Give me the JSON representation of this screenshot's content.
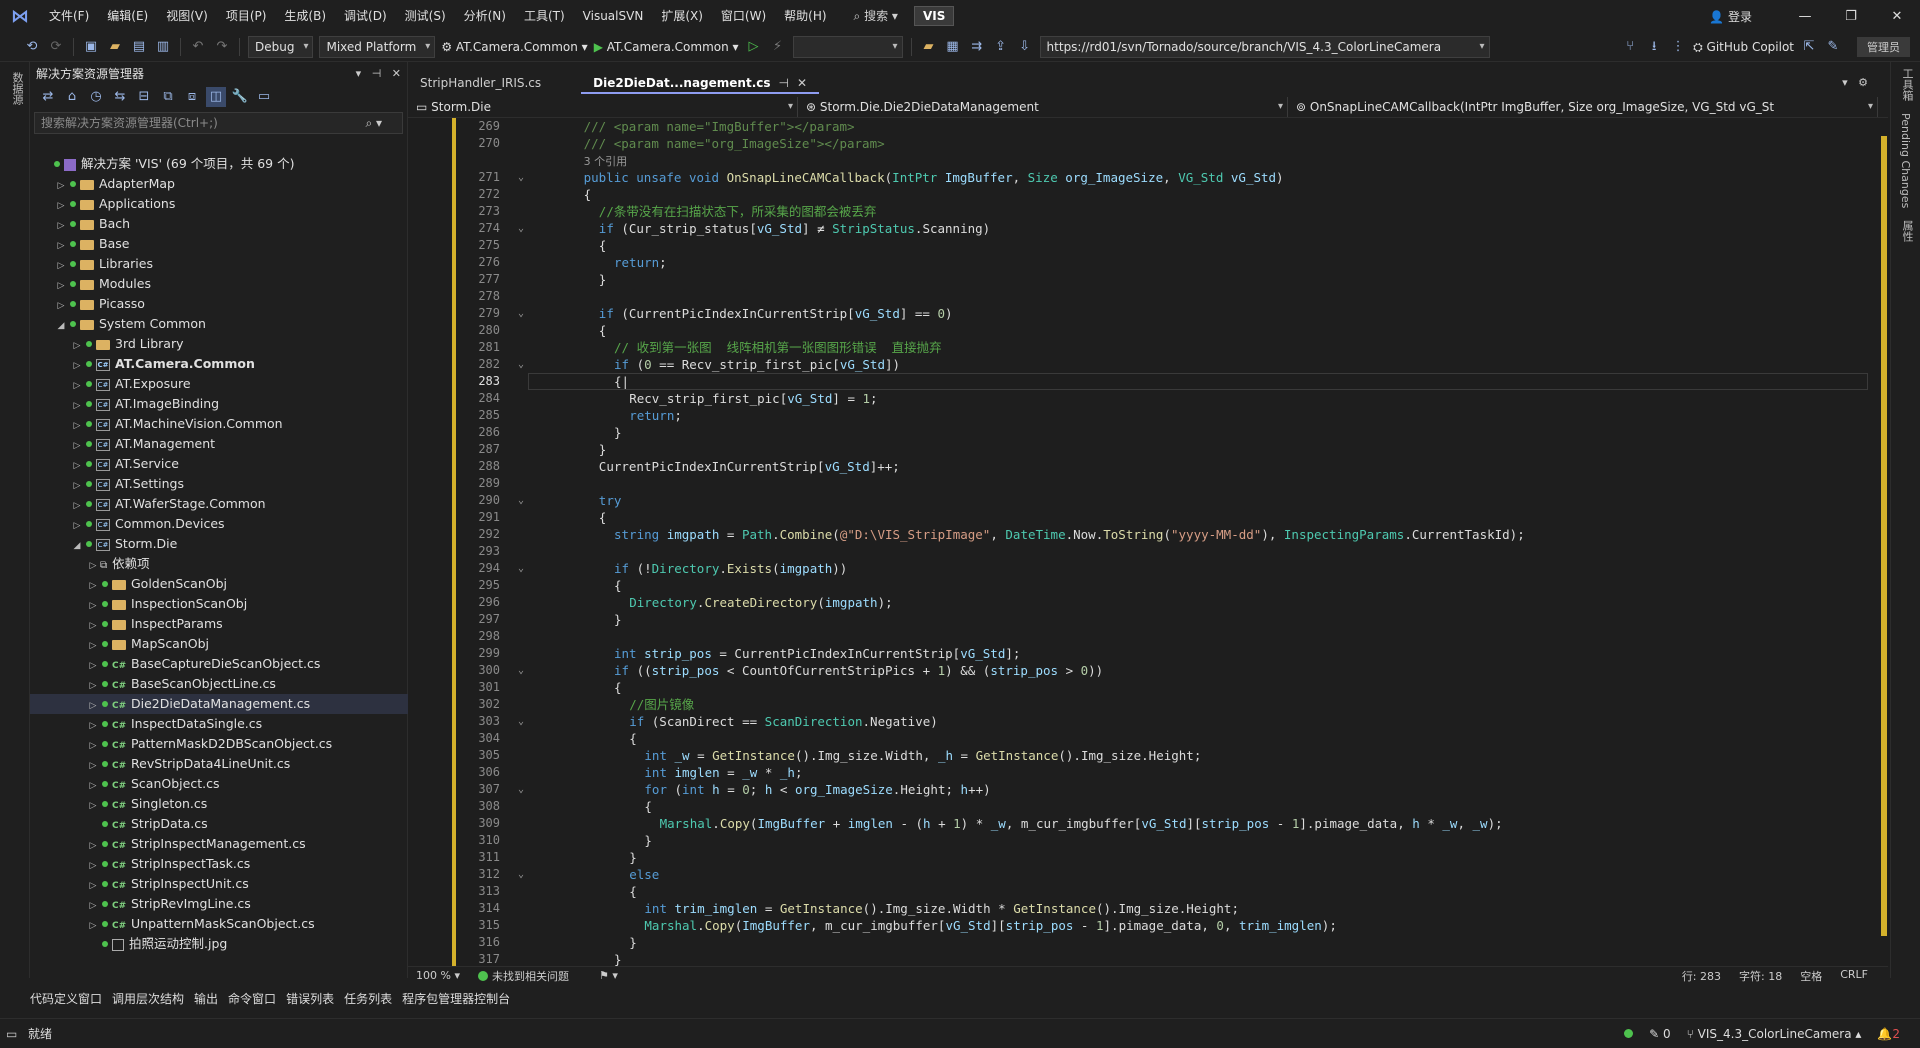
{
  "menu": {
    "items": [
      "文件(F)",
      "编辑(E)",
      "视图(V)",
      "项目(P)",
      "生成(B)",
      "调试(D)",
      "测试(S)",
      "分析(N)",
      "工具(T)",
      "VisualSVN",
      "扩展(X)",
      "窗口(W)",
      "帮助(H)"
    ],
    "search": "搜索",
    "solution_badge": "VIS",
    "login": "登录"
  },
  "toolbar": {
    "config": "Debug",
    "platform": "Mixed Platform",
    "startup_project": "AT.Camera.Common",
    "run_target": "AT.Camera.Common",
    "url": "https://rd01/svn/Tornado/source/branch/VIS_4.3_ColorLineCamera",
    "copilot": "GitHub Copilot",
    "admin": "管理员"
  },
  "left_strip": {
    "label": "数据源"
  },
  "solution_explorer": {
    "title": "解决方案资源管理器",
    "search_placeholder": "搜索解决方案资源管理器(Ctrl+;)",
    "tree": [
      {
        "label": "解决方案 'VIS' (69 个项目，共 69 个)",
        "indent": 0,
        "kind": "solution",
        "arrow": ""
      },
      {
        "label": "AdapterMap",
        "indent": 1,
        "kind": "folder",
        "arrow": "▷"
      },
      {
        "label": "Applications",
        "indent": 1,
        "kind": "folder",
        "arrow": "▷"
      },
      {
        "label": "Bach",
        "indent": 1,
        "kind": "folder",
        "arrow": "▷"
      },
      {
        "label": "Base",
        "indent": 1,
        "kind": "folder",
        "arrow": "▷"
      },
      {
        "label": "Libraries",
        "indent": 1,
        "kind": "folder",
        "arrow": "▷"
      },
      {
        "label": "Modules",
        "indent": 1,
        "kind": "folder",
        "arrow": "▷"
      },
      {
        "label": "Picasso",
        "indent": 1,
        "kind": "folder",
        "arrow": "▷"
      },
      {
        "label": "System Common",
        "indent": 1,
        "kind": "folder",
        "arrow": "◢"
      },
      {
        "label": "3rd Library",
        "indent": 2,
        "kind": "folder",
        "arrow": "▷"
      },
      {
        "label": "AT.Camera.Common",
        "indent": 2,
        "kind": "proj",
        "arrow": "▷",
        "bold": true
      },
      {
        "label": "AT.Exposure",
        "indent": 2,
        "kind": "proj",
        "arrow": "▷"
      },
      {
        "label": "AT.ImageBinding",
        "indent": 2,
        "kind": "proj",
        "arrow": "▷"
      },
      {
        "label": "AT.MachineVision.Common",
        "indent": 2,
        "kind": "proj",
        "arrow": "▷"
      },
      {
        "label": "AT.Management",
        "indent": 2,
        "kind": "proj",
        "arrow": "▷"
      },
      {
        "label": "AT.Service",
        "indent": 2,
        "kind": "proj",
        "arrow": "▷"
      },
      {
        "label": "AT.Settings",
        "indent": 2,
        "kind": "proj",
        "arrow": "▷"
      },
      {
        "label": "AT.WaferStage.Common",
        "indent": 2,
        "kind": "proj",
        "arrow": "▷"
      },
      {
        "label": "Common.Devices",
        "indent": 2,
        "kind": "proj",
        "arrow": "▷"
      },
      {
        "label": "Storm.Die",
        "indent": 2,
        "kind": "proj",
        "arrow": "◢"
      },
      {
        "label": "依赖项",
        "indent": 3,
        "kind": "dep",
        "arrow": "▷"
      },
      {
        "label": "GoldenScanObj",
        "indent": 3,
        "kind": "folder",
        "arrow": "▷"
      },
      {
        "label": "InspectionScanObj",
        "indent": 3,
        "kind": "folder",
        "arrow": "▷"
      },
      {
        "label": "InspectParams",
        "indent": 3,
        "kind": "folder",
        "arrow": "▷"
      },
      {
        "label": "MapScanObj",
        "indent": 3,
        "kind": "folder",
        "arrow": "▷"
      },
      {
        "label": "BaseCaptureDieScanObject.cs",
        "indent": 3,
        "kind": "cs",
        "arrow": "▷"
      },
      {
        "label": "BaseScanObjectLine.cs",
        "indent": 3,
        "kind": "cs",
        "arrow": "▷"
      },
      {
        "label": "Die2DieDataManagement.cs",
        "indent": 3,
        "kind": "cs",
        "arrow": "▷",
        "selected": true
      },
      {
        "label": "InspectDataSingle.cs",
        "indent": 3,
        "kind": "cs",
        "arrow": "▷"
      },
      {
        "label": "PatternMaskD2DBScanObject.cs",
        "indent": 3,
        "kind": "cs",
        "arrow": "▷"
      },
      {
        "label": "RevStripData4LineUnit.cs",
        "indent": 3,
        "kind": "cs",
        "arrow": "▷"
      },
      {
        "label": "ScanObject.cs",
        "indent": 3,
        "kind": "cs",
        "arrow": "▷"
      },
      {
        "label": "Singleton.cs",
        "indent": 3,
        "kind": "cs",
        "arrow": "▷"
      },
      {
        "label": "StripData.cs",
        "indent": 3,
        "kind": "cs",
        "arrow": ""
      },
      {
        "label": "StripInspectManagement.cs",
        "indent": 3,
        "kind": "cs",
        "arrow": "▷"
      },
      {
        "label": "StripInspectTask.cs",
        "indent": 3,
        "kind": "cs",
        "arrow": "▷"
      },
      {
        "label": "StripInspectUnit.cs",
        "indent": 3,
        "kind": "cs",
        "arrow": "▷"
      },
      {
        "label": "StripRevImgLine.cs",
        "indent": 3,
        "kind": "cs",
        "arrow": "▷"
      },
      {
        "label": "UnpatternMaskScanObject.cs",
        "indent": 3,
        "kind": "cs",
        "arrow": "▷"
      },
      {
        "label": "拍照运动控制.jpg",
        "indent": 3,
        "kind": "img",
        "arrow": ""
      }
    ]
  },
  "tabs": [
    {
      "label": "StripHandler_IRIS.cs",
      "active": false
    },
    {
      "label": "Die2DieDat...nagement.cs",
      "active": true
    }
  ],
  "navbar": {
    "project": "Storm.Die",
    "class": "Storm.Die.Die2DieDataManagement",
    "member": "OnSnapLineCAMCallback(IntPtr ImgBuffer, Size org_ImageSize, VG_Std vG_St"
  },
  "code": {
    "current_line": 283,
    "lines": [
      {
        "n": "269",
        "h": "<span class='xml'>/// &lt;param name=\"</span><span class='xml'>ImgBuffer</span><span class='xml'>\"&gt;&lt;/param&gt;</span>",
        "i": 6
      },
      {
        "n": "270",
        "h": "<span class='xml'>/// &lt;param name=\"org_ImageSize\"&gt;&lt;/param&gt;</span>",
        "i": 6
      },
      {
        "n": "",
        "h": "<span class='ref'>3 个引用</span>",
        "i": 6
      },
      {
        "n": "271",
        "h": "<span class='kw'>public unsafe void</span> <span class='mt'>OnSnapLineCAMCallback</span>(<span class='ty'>IntPtr</span> <span class='pa'>ImgBuffer</span>, <span class='ty'>Size</span> <span class='pa'>org_ImageSize</span>, <span class='ty'>VG_Std</span> <span class='pa'>vG_Std</span>)",
        "i": 6,
        "f": "⌄"
      },
      {
        "n": "272",
        "h": "{",
        "i": 6
      },
      {
        "n": "273",
        "h": "<span class='cm'>//条带没有在扫描状态下，所采集的图都会被丢弃</span>",
        "i": 8
      },
      {
        "n": "274",
        "h": "<span class='kw'>if</span> (Cur_strip_status[<span class='pa'>vG_Std</span>] ≠ <span class='ty'>StripStatus</span>.Scanning)",
        "i": 8,
        "f": "⌄"
      },
      {
        "n": "275",
        "h": "{",
        "i": 8
      },
      {
        "n": "276",
        "h": "<span class='kw'>return</span>;",
        "i": 10
      },
      {
        "n": "277",
        "h": "}",
        "i": 8
      },
      {
        "n": "278",
        "h": "",
        "i": 8
      },
      {
        "n": "279",
        "h": "<span class='kw'>if</span> (CurrentPicIndexInCurrentStrip[<span class='pa'>vG_Std</span>] == <span class='nu'>0</span>)",
        "i": 8,
        "f": "⌄"
      },
      {
        "n": "280",
        "h": "{",
        "i": 8
      },
      {
        "n": "281",
        "h": "<span class='cm'>// 收到第一张图  线阵相机第一张图图形错误  直接抛弃</span>",
        "i": 10
      },
      {
        "n": "282",
        "h": "<span class='kw'>if</span> (<span class='nu'>0</span> == Recv_strip_first_pic[<span class='pa'>vG_Std</span>])",
        "i": 10,
        "f": "⌄"
      },
      {
        "n": "283",
        "h": "{|",
        "i": 10
      },
      {
        "n": "284",
        "h": "Recv_strip_first_pic[<span class='pa'>vG_Std</span>] = <span class='nu'>1</span>;",
        "i": 12
      },
      {
        "n": "285",
        "h": "<span class='kw'>return</span>;",
        "i": 12
      },
      {
        "n": "286",
        "h": "}",
        "i": 10
      },
      {
        "n": "287",
        "h": "}",
        "i": 8
      },
      {
        "n": "288",
        "h": "CurrentPicIndexInCurrentStrip[<span class='pa'>vG_Std</span>]++;",
        "i": 8
      },
      {
        "n": "289",
        "h": "",
        "i": 8
      },
      {
        "n": "290",
        "h": "<span class='kw'>try</span>",
        "i": 8,
        "f": "⌄"
      },
      {
        "n": "291",
        "h": "{",
        "i": 8
      },
      {
        "n": "292",
        "h": "<span class='kw'>string</span> <span class='pa'>imgpath</span> = <span class='ty'>Path</span>.<span class='mt'>Combine</span>(<span class='st'>@\"D:\\VIS_StripImage\"</span>, <span class='ty'>DateTime</span>.Now.<span class='mt'>ToString</span>(<span class='st'>\"yyyy-MM-dd\"</span>), <span class='ty'>InspectingParams</span>.CurrentTaskId);",
        "i": 10
      },
      {
        "n": "293",
        "h": "",
        "i": 10
      },
      {
        "n": "294",
        "h": "<span class='kw'>if</span> (!<span class='ty'>Directory</span>.<span class='mt'>Exists</span>(<span class='pa'>imgpath</span>))",
        "i": 10,
        "f": "⌄"
      },
      {
        "n": "295",
        "h": "{",
        "i": 10
      },
      {
        "n": "296",
        "h": "<span class='ty'>Directory</span>.<span class='mt'>CreateDirectory</span>(<span class='pa'>imgpath</span>);",
        "i": 12
      },
      {
        "n": "297",
        "h": "}",
        "i": 10
      },
      {
        "n": "298",
        "h": "",
        "i": 10
      },
      {
        "n": "299",
        "h": "<span class='kw'>int</span> <span class='pa'>strip_pos</span> = CurrentPicIndexInCurrentStrip[<span class='pa'>vG_Std</span>];",
        "i": 10
      },
      {
        "n": "300",
        "h": "<span class='kw'>if</span> ((<span class='pa'>strip_pos</span> &lt; CountOfCurrentStripPics + <span class='nu'>1</span>) &amp;&amp; (<span class='pa'>strip_pos</span> &gt; <span class='nu'>0</span>))",
        "i": 10,
        "f": "⌄"
      },
      {
        "n": "301",
        "h": "{",
        "i": 10
      },
      {
        "n": "302",
        "h": "<span class='cm'>//图片镜像</span>",
        "i": 12
      },
      {
        "n": "303",
        "h": "<span class='kw'>if</span> (ScanDirect == <span class='ty'>ScanDirection</span>.Negative)",
        "i": 12,
        "f": "⌄"
      },
      {
        "n": "304",
        "h": "{",
        "i": 12
      },
      {
        "n": "305",
        "h": "<span class='kw'>int</span> <span class='pa'>_w</span> = <span class='mt'>GetInstance</span>().Img_size.Width, <span class='pa'>_h</span> = <span class='mt'>GetInstance</span>().Img_size.Height;",
        "i": 14
      },
      {
        "n": "306",
        "h": "<span class='kw'>int</span> <span class='pa'>imglen</span> = <span class='pa'>_w</span> * <span class='pa'>_h</span>;",
        "i": 14
      },
      {
        "n": "307",
        "h": "<span class='kw'>for</span> (<span class='kw'>int</span> <span class='pa'>h</span> = <span class='nu'>0</span>; <span class='pa'>h</span> &lt; <span class='pa'>org_ImageSize</span>.Height; <span class='pa'>h</span>++)",
        "i": 14,
        "f": "⌄"
      },
      {
        "n": "308",
        "h": "{",
        "i": 14
      },
      {
        "n": "309",
        "h": "<span class='ty'>Marshal</span>.<span class='mt'>Copy</span>(<span class='pa'>ImgBuffer</span> + <span class='pa'>imglen</span> - (<span class='pa'>h</span> + <span class='nu'>1</span>) * <span class='pa'>_w</span>, m_cur_imgbuffer[<span class='pa'>vG_Std</span>][<span class='pa'>strip_pos</span> - <span class='nu'>1</span>].pimage_data, <span class='pa'>h</span> * <span class='pa'>_w</span>, <span class='pa'>_w</span>);",
        "i": 16
      },
      {
        "n": "310",
        "h": "}",
        "i": 14
      },
      {
        "n": "311",
        "h": "}",
        "i": 12
      },
      {
        "n": "312",
        "h": "<span class='kw'>else</span>",
        "i": 12,
        "f": "⌄"
      },
      {
        "n": "313",
        "h": "{",
        "i": 12
      },
      {
        "n": "314",
        "h": "<span class='kw'>int</span> <span class='pa'>trim_imglen</span> = <span class='mt'>GetInstance</span>().Img_size.Width * <span class='mt'>GetInstance</span>().Img_size.Height;",
        "i": 14
      },
      {
        "n": "315",
        "h": "<span class='ty'>Marshal</span>.<span class='mt'>Copy</span>(<span class='pa'>ImgBuffer</span>, m_cur_imgbuffer[<span class='pa'>vG_Std</span>][<span class='pa'>strip_pos</span> - <span class='nu'>1</span>].pimage_data, <span class='nu'>0</span>, <span class='pa'>trim_imglen</span>);",
        "i": 14
      },
      {
        "n": "316",
        "h": "}",
        "i": 12
      },
      {
        "n": "317",
        "h": "}",
        "i": 10
      }
    ]
  },
  "editor_status": {
    "zoom": "100 %",
    "issues": "未找到相关问题",
    "line": "行: 283",
    "char": "字符: 18",
    "whitespace": "空格",
    "eol": "CRLF"
  },
  "right_strip": {
    "labels": [
      "工具箱",
      "Pending Changes",
      "属性"
    ]
  },
  "bottom_tabs": [
    "代码定义窗口",
    "调用层次结构",
    "输出",
    "命令窗口",
    "错误列表",
    "任务列表",
    "程序包管理器控制台"
  ],
  "status_bar": {
    "ready": "就绪",
    "errors": "0",
    "branch": "VIS_4.3_ColorLineCamera",
    "notifications": "2"
  }
}
